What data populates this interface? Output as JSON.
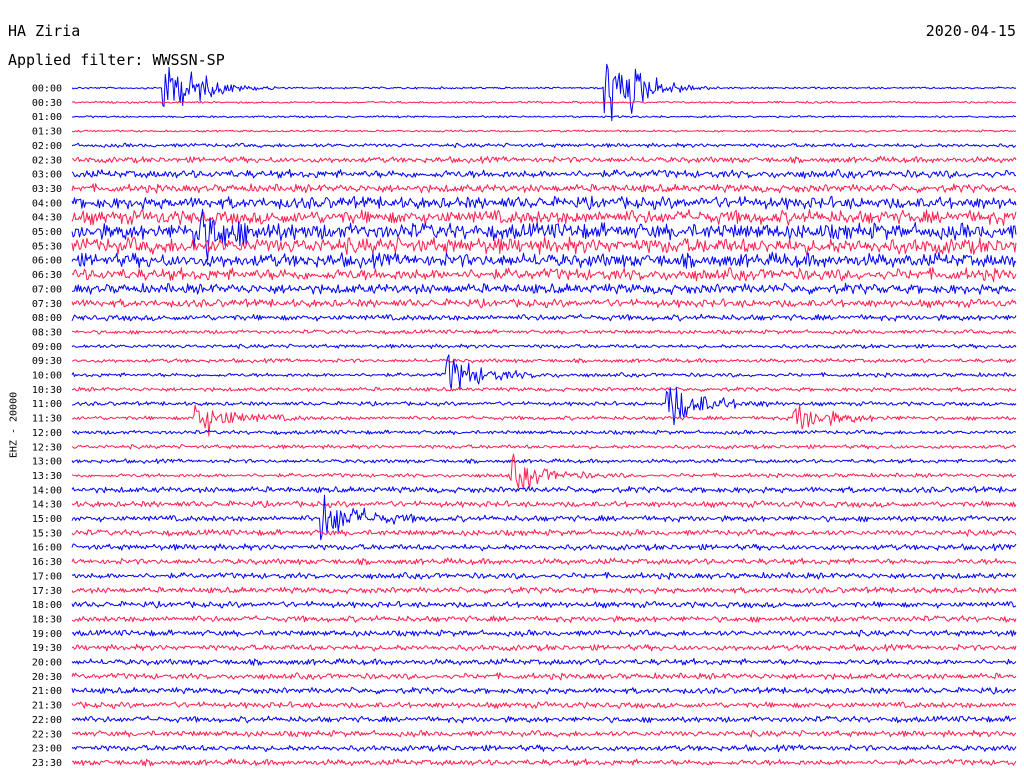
{
  "header": {
    "station": "HA Ziria",
    "filter": "Applied filter: WWSSN-SP",
    "date": "2020-04-15"
  },
  "channel_label": "EHZ - 20000",
  "colors": {
    "trace_a": "#0000ff",
    "trace_b": "#ff1f4f",
    "text": "#000000",
    "background": "#ffffff"
  },
  "chart_data": {
    "type": "line",
    "title": "",
    "xlabel": "",
    "ylabel": "EHZ - 20000",
    "y_tick_labels": [
      "00:00",
      "00:30",
      "01:00",
      "01:30",
      "02:00",
      "02:30",
      "03:00",
      "03:30",
      "04:00",
      "04:30",
      "05:00",
      "05:30",
      "06:00",
      "06:30",
      "07:00",
      "07:30",
      "08:00",
      "08:30",
      "09:00",
      "09:30",
      "10:00",
      "10:30",
      "11:00",
      "11:30",
      "12:00",
      "12:30",
      "13:00",
      "13:30",
      "14:00",
      "14:30",
      "15:00",
      "15:30",
      "16:00",
      "16:30",
      "17:00",
      "17:30",
      "18:00",
      "18:30",
      "19:00",
      "19:30",
      "20:00",
      "20:30",
      "21:00",
      "21:30",
      "22:00",
      "22:30",
      "23:00",
      "23:30"
    ],
    "row_minutes": 30,
    "row_colors": [
      "trace_a",
      "trace_b"
    ],
    "row_noise_level": [
      1,
      1,
      1,
      1,
      2,
      3,
      4,
      4,
      6,
      7,
      8,
      8,
      7,
      6,
      5,
      4,
      3,
      2,
      2,
      2,
      2,
      2,
      2,
      2,
      2,
      2,
      2,
      2,
      3,
      3,
      3,
      3,
      3,
      3,
      3,
      3,
      3,
      3,
      3,
      3,
      3,
      3,
      3,
      3,
      3,
      3,
      3,
      3
    ],
    "events": [
      {
        "row": 10,
        "minute": 4,
        "amp": 6
      },
      {
        "row": 20,
        "minute": 12,
        "amp": 5
      },
      {
        "row": 22,
        "minute": 19,
        "amp": 6
      },
      {
        "row": 23,
        "minute": 4,
        "amp": 5
      },
      {
        "row": 23,
        "minute": 23,
        "amp": 4
      },
      {
        "row": 27,
        "minute": 14,
        "amp": 4
      },
      {
        "row": 30,
        "minute": 8,
        "amp": 6
      },
      {
        "row": 0,
        "minute": 3,
        "amp": 9
      },
      {
        "row": 0,
        "minute": 17,
        "amp": 12
      }
    ]
  }
}
